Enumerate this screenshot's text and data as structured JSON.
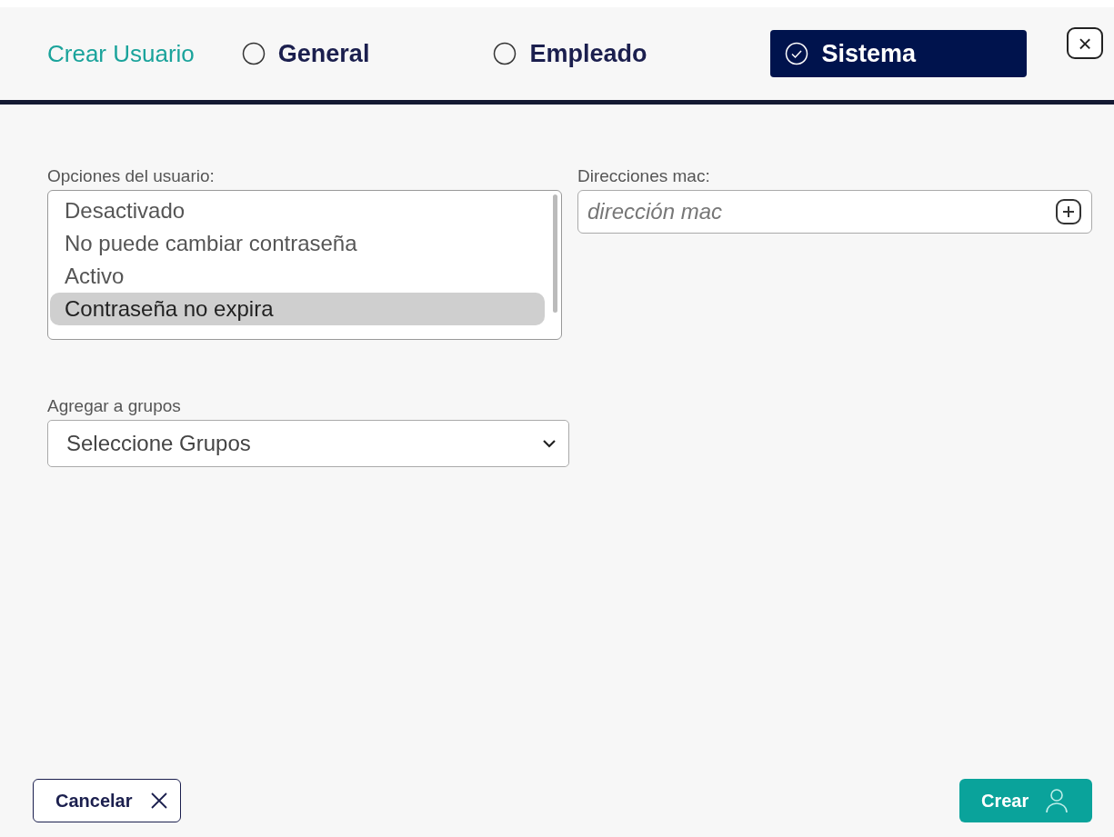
{
  "header": {
    "title": "Crear Usuario",
    "close": "×"
  },
  "tabs": [
    {
      "label": "General",
      "selected": false
    },
    {
      "label": "Empleado",
      "selected": false
    },
    {
      "label": "Sistema",
      "selected": true
    }
  ],
  "user_options": {
    "label": "Opciones del usuario:",
    "items": [
      {
        "label": "Desactivado",
        "selected": false
      },
      {
        "label": "No puede cambiar contraseña",
        "selected": false
      },
      {
        "label": "Activo",
        "selected": false
      },
      {
        "label": "Contraseña no expira",
        "selected": true
      }
    ]
  },
  "mac_addresses": {
    "label": "Direcciones mac:",
    "placeholder": "dirección mac"
  },
  "groups": {
    "label": "Agregar a grupos",
    "placeholder": "Seleccione Grupos"
  },
  "buttons": {
    "cancel": "Cancelar",
    "create": "Crear"
  }
}
